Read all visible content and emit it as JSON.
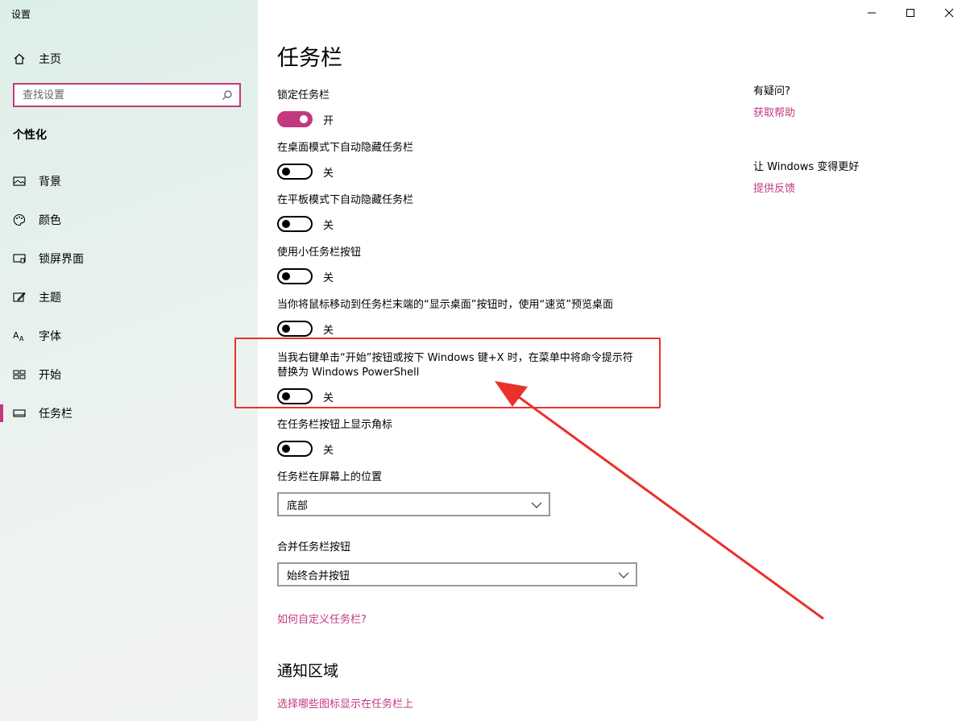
{
  "window": {
    "title": "设置"
  },
  "sidebar": {
    "home_label": "主页",
    "search_placeholder": "查找设置",
    "section_title": "个性化",
    "items": [
      {
        "label": "背景",
        "icon": "image-icon"
      },
      {
        "label": "颜色",
        "icon": "palette-icon"
      },
      {
        "label": "锁屏界面",
        "icon": "lock-screen-icon"
      },
      {
        "label": "主题",
        "icon": "theme-icon"
      },
      {
        "label": "字体",
        "icon": "font-icon"
      },
      {
        "label": "开始",
        "icon": "start-icon"
      },
      {
        "label": "任务栏",
        "icon": "taskbar-icon",
        "active": true
      }
    ]
  },
  "main": {
    "title": "任务栏",
    "settings": [
      {
        "label": "锁定任务栏",
        "state": "开",
        "on": true
      },
      {
        "label": "在桌面模式下自动隐藏任务栏",
        "state": "关",
        "on": false
      },
      {
        "label": "在平板模式下自动隐藏任务栏",
        "state": "关",
        "on": false
      },
      {
        "label": "使用小任务栏按钮",
        "state": "关",
        "on": false
      },
      {
        "label": "当你将鼠标移动到任务栏末端的“显示桌面”按钮时，使用“速览”预览桌面",
        "state": "关",
        "on": false
      },
      {
        "label": "当我右键单击“开始”按钮或按下 Windows 键+X 时，在菜单中将命令提示符替换为 Windows PowerShell",
        "state": "关",
        "on": false
      },
      {
        "label": "在任务栏按钮上显示角标",
        "state": "关",
        "on": false
      }
    ],
    "position": {
      "label": "任务栏在屏幕上的位置",
      "value": "底部"
    },
    "combine": {
      "label": "合并任务栏按钮",
      "value": "始终合并按钮"
    },
    "customize_link": "如何自定义任务栏?",
    "notification_heading": "通知区域",
    "notification_link": "选择哪些图标显示在任务栏上"
  },
  "aside": {
    "help_heading": "有疑问?",
    "help_link": "获取帮助",
    "feedback_heading": "让 Windows 变得更好",
    "feedback_link": "提供反馈"
  },
  "colors": {
    "accent": "#c2397f",
    "annotation": "#e8322b"
  }
}
